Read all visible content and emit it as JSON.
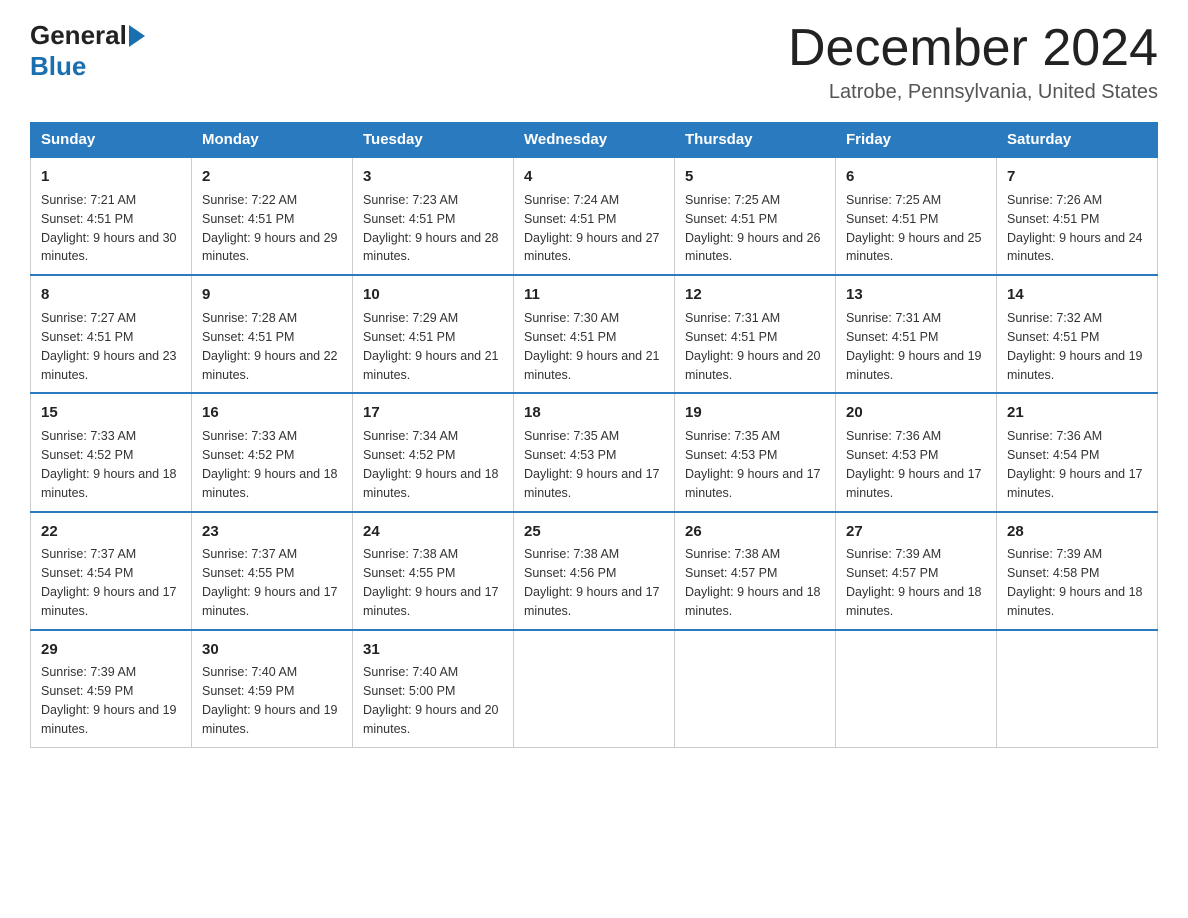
{
  "header": {
    "logo_text_general": "General",
    "logo_text_blue": "Blue",
    "month_title": "December 2024",
    "location": "Latrobe, Pennsylvania, United States"
  },
  "days_of_week": [
    "Sunday",
    "Monday",
    "Tuesday",
    "Wednesday",
    "Thursday",
    "Friday",
    "Saturday"
  ],
  "weeks": [
    [
      {
        "num": "1",
        "sunrise": "7:21 AM",
        "sunset": "4:51 PM",
        "daylight": "9 hours and 30 minutes."
      },
      {
        "num": "2",
        "sunrise": "7:22 AM",
        "sunset": "4:51 PM",
        "daylight": "9 hours and 29 minutes."
      },
      {
        "num": "3",
        "sunrise": "7:23 AM",
        "sunset": "4:51 PM",
        "daylight": "9 hours and 28 minutes."
      },
      {
        "num": "4",
        "sunrise": "7:24 AM",
        "sunset": "4:51 PM",
        "daylight": "9 hours and 27 minutes."
      },
      {
        "num": "5",
        "sunrise": "7:25 AM",
        "sunset": "4:51 PM",
        "daylight": "9 hours and 26 minutes."
      },
      {
        "num": "6",
        "sunrise": "7:25 AM",
        "sunset": "4:51 PM",
        "daylight": "9 hours and 25 minutes."
      },
      {
        "num": "7",
        "sunrise": "7:26 AM",
        "sunset": "4:51 PM",
        "daylight": "9 hours and 24 minutes."
      }
    ],
    [
      {
        "num": "8",
        "sunrise": "7:27 AM",
        "sunset": "4:51 PM",
        "daylight": "9 hours and 23 minutes."
      },
      {
        "num": "9",
        "sunrise": "7:28 AM",
        "sunset": "4:51 PM",
        "daylight": "9 hours and 22 minutes."
      },
      {
        "num": "10",
        "sunrise": "7:29 AM",
        "sunset": "4:51 PM",
        "daylight": "9 hours and 21 minutes."
      },
      {
        "num": "11",
        "sunrise": "7:30 AM",
        "sunset": "4:51 PM",
        "daylight": "9 hours and 21 minutes."
      },
      {
        "num": "12",
        "sunrise": "7:31 AM",
        "sunset": "4:51 PM",
        "daylight": "9 hours and 20 minutes."
      },
      {
        "num": "13",
        "sunrise": "7:31 AM",
        "sunset": "4:51 PM",
        "daylight": "9 hours and 19 minutes."
      },
      {
        "num": "14",
        "sunrise": "7:32 AM",
        "sunset": "4:51 PM",
        "daylight": "9 hours and 19 minutes."
      }
    ],
    [
      {
        "num": "15",
        "sunrise": "7:33 AM",
        "sunset": "4:52 PM",
        "daylight": "9 hours and 18 minutes."
      },
      {
        "num": "16",
        "sunrise": "7:33 AM",
        "sunset": "4:52 PM",
        "daylight": "9 hours and 18 minutes."
      },
      {
        "num": "17",
        "sunrise": "7:34 AM",
        "sunset": "4:52 PM",
        "daylight": "9 hours and 18 minutes."
      },
      {
        "num": "18",
        "sunrise": "7:35 AM",
        "sunset": "4:53 PM",
        "daylight": "9 hours and 17 minutes."
      },
      {
        "num": "19",
        "sunrise": "7:35 AM",
        "sunset": "4:53 PM",
        "daylight": "9 hours and 17 minutes."
      },
      {
        "num": "20",
        "sunrise": "7:36 AM",
        "sunset": "4:53 PM",
        "daylight": "9 hours and 17 minutes."
      },
      {
        "num": "21",
        "sunrise": "7:36 AM",
        "sunset": "4:54 PM",
        "daylight": "9 hours and 17 minutes."
      }
    ],
    [
      {
        "num": "22",
        "sunrise": "7:37 AM",
        "sunset": "4:54 PM",
        "daylight": "9 hours and 17 minutes."
      },
      {
        "num": "23",
        "sunrise": "7:37 AM",
        "sunset": "4:55 PM",
        "daylight": "9 hours and 17 minutes."
      },
      {
        "num": "24",
        "sunrise": "7:38 AM",
        "sunset": "4:55 PM",
        "daylight": "9 hours and 17 minutes."
      },
      {
        "num": "25",
        "sunrise": "7:38 AM",
        "sunset": "4:56 PM",
        "daylight": "9 hours and 17 minutes."
      },
      {
        "num": "26",
        "sunrise": "7:38 AM",
        "sunset": "4:57 PM",
        "daylight": "9 hours and 18 minutes."
      },
      {
        "num": "27",
        "sunrise": "7:39 AM",
        "sunset": "4:57 PM",
        "daylight": "9 hours and 18 minutes."
      },
      {
        "num": "28",
        "sunrise": "7:39 AM",
        "sunset": "4:58 PM",
        "daylight": "9 hours and 18 minutes."
      }
    ],
    [
      {
        "num": "29",
        "sunrise": "7:39 AM",
        "sunset": "4:59 PM",
        "daylight": "9 hours and 19 minutes."
      },
      {
        "num": "30",
        "sunrise": "7:40 AM",
        "sunset": "4:59 PM",
        "daylight": "9 hours and 19 minutes."
      },
      {
        "num": "31",
        "sunrise": "7:40 AM",
        "sunset": "5:00 PM",
        "daylight": "9 hours and 20 minutes."
      },
      null,
      null,
      null,
      null
    ]
  ]
}
